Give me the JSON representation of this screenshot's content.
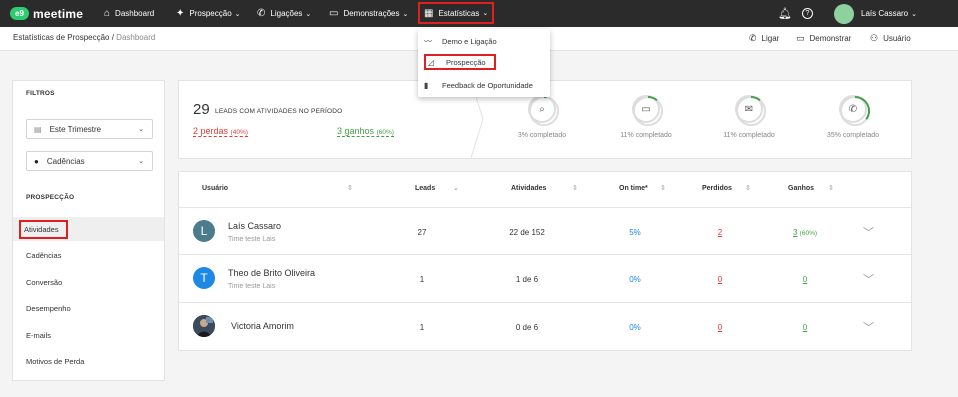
{
  "topbar": {
    "logo_mark": "e9",
    "logo_text": "meetime",
    "nav": [
      {
        "label": "Dashboard",
        "icon": "home-icon"
      },
      {
        "label": "Prospecção",
        "icon": "gear-icon"
      },
      {
        "label": "Ligações",
        "icon": "phone-icon"
      },
      {
        "label": "Demonstrações",
        "icon": "monitor-icon"
      },
      {
        "label": "Estatísticas",
        "icon": "chart-icon"
      }
    ],
    "user_name": "Laís Cassaro"
  },
  "statsmenu": {
    "items": [
      {
        "label": "Demo e Ligação",
        "icon": "trend-icon"
      },
      {
        "label": "Prospecção",
        "icon": "area-chart-icon"
      },
      {
        "label": "Feedback de Oportunidade",
        "icon": "bar-chart-icon"
      }
    ]
  },
  "subbar": {
    "breadcrumb_parent": "Estatísticas de Prospecção /",
    "breadcrumb_current": "Dashboard",
    "actions": {
      "ligar": "Ligar",
      "demonstrar": "Demonstrar",
      "usuario": "Usuário"
    }
  },
  "sidebar": {
    "filters_title": "FILTROS",
    "period_select": "Este Trimestre",
    "cadence_select": "Cadências",
    "section_title": "PROSPECÇÃO",
    "items": [
      "Atividades",
      "Cadências",
      "Conversão",
      "Desempenho",
      "E-mails",
      "Motivos de Perda"
    ]
  },
  "summary": {
    "leads_count": "29",
    "leads_label": "LEADS COM ATIVIDADES NO PERÍODO",
    "perdas_text": "2 perdas",
    "perdas_pct": "(40%)",
    "ganhos_text": "3 ganhos",
    "ganhos_pct": "(60%)",
    "kpis": [
      {
        "label": "3% completado",
        "icon": "search-icon",
        "progress": 0.03
      },
      {
        "label": "11% completado",
        "icon": "chat-icon",
        "progress": 0.11
      },
      {
        "label": "11% completado",
        "icon": "mail-icon",
        "progress": 0.11
      },
      {
        "label": "35% completado",
        "icon": "phone-icon",
        "progress": 0.35
      }
    ]
  },
  "table": {
    "headers": {
      "usuario": "Usuário",
      "leads": "Leads",
      "atividades": "Atividades",
      "ontime": "On time*",
      "perdidos": "Perdidos",
      "ganhos": "Ganhos"
    },
    "rows": [
      {
        "initial": "L",
        "name": "Laís Cassaro",
        "team": "Time teste Lais",
        "leads": "27",
        "atividades": "22 de 152",
        "ontime": "5%",
        "perdidos": "2",
        "ganhos": "3",
        "ganhos_pct": "(60%)",
        "avatar_color": "#4a7c8c"
      },
      {
        "initial": "T",
        "name": "Theo de Brito Oliveira",
        "team": "Time teste Lais",
        "leads": "1",
        "atividades": "1 de 6",
        "ontime": "0%",
        "perdidos": "0",
        "ganhos": "0",
        "ganhos_pct": "",
        "avatar_color": "#1e88e5"
      },
      {
        "initial": "",
        "name": "Victoria Amorim",
        "team": "",
        "leads": "1",
        "atividades": "0 de 6",
        "ontime": "0%",
        "perdidos": "0",
        "ganhos": "0",
        "ganhos_pct": "",
        "avatar_color": "#2d3a4a"
      }
    ]
  },
  "colors": {
    "accent_green": "#43a047",
    "loss_red": "#e53935",
    "highlight": "#e02020",
    "link_blue": "#1e88e5"
  }
}
